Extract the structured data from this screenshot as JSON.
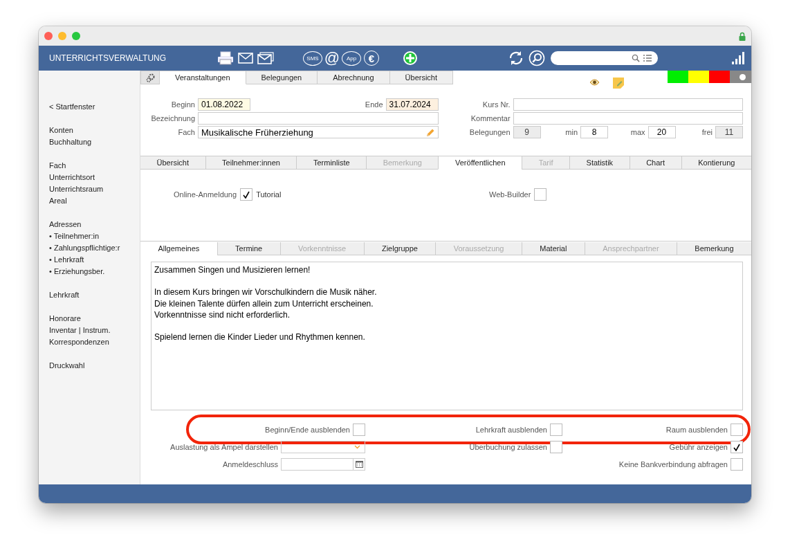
{
  "app": {
    "title": "UNTERRICHTSVERWALTUNG",
    "sms_label": "SMS",
    "at_label": "@",
    "app_label": "App",
    "euro_label": "€"
  },
  "status_colors": [
    {
      "color": "#00ee00"
    },
    {
      "color": "#ffff00"
    },
    {
      "color": "#ff0000"
    }
  ],
  "status_toggle": {
    "on": false
  },
  "top_tabs": [
    {
      "label": "Veranstaltungen",
      "selected": true
    },
    {
      "label": "Belegungen",
      "selected": false
    },
    {
      "label": "Abrechnung",
      "selected": false
    },
    {
      "label": "Übersicht",
      "selected": false
    }
  ],
  "sidebar": {
    "groups": [
      [
        {
          "label": "< Startfenster"
        }
      ],
      [
        {
          "label": "Konten"
        },
        {
          "label": "Buchhaltung"
        }
      ],
      [
        {
          "label": "Fach"
        },
        {
          "label": "Unterrichtsort"
        },
        {
          "label": "Unterrichtsraum"
        },
        {
          "label": "Areal"
        }
      ],
      [
        {
          "label": "Adressen"
        },
        {
          "label": "• Teilnehmer:in"
        },
        {
          "label": "• Zahlungspflichtige:r"
        },
        {
          "label": "• Lehrkraft"
        },
        {
          "label": "• Erziehungsber."
        }
      ],
      [
        {
          "label": "Lehrkraft"
        }
      ],
      [
        {
          "label": "Honorare"
        },
        {
          "label": "Inventar | Instrum."
        },
        {
          "label": "Korrespondenzen"
        }
      ],
      [
        {
          "label": "Druckwahl"
        }
      ]
    ]
  },
  "form": {
    "beginn": {
      "label": "Beginn",
      "value": "01.08.2022"
    },
    "ende": {
      "label": "Ende",
      "value": "31.07.2024"
    },
    "bezeichnung": {
      "label": "Bezeichnung"
    },
    "fach": {
      "label": "Fach",
      "value": "Musikalische Früherziehung"
    },
    "kurs_nr": {
      "label": "Kurs Nr."
    },
    "kommentar": {
      "label": "Kommentar"
    },
    "belegungen": {
      "label": "Belegungen",
      "value": "9"
    },
    "min": {
      "label": "min",
      "value": "8"
    },
    "max": {
      "label": "max",
      "value": "20"
    },
    "frei": {
      "label": "frei",
      "value": "11"
    }
  },
  "sub_tabs": [
    {
      "label": "Übersicht",
      "selected": false,
      "disabled": false
    },
    {
      "label": "Teilnehmer:innen",
      "selected": false,
      "disabled": false
    },
    {
      "label": "Terminliste",
      "selected": false,
      "disabled": false
    },
    {
      "label": "Bemerkung",
      "selected": false,
      "disabled": true
    },
    {
      "label": "Veröffentlichen",
      "selected": true,
      "disabled": false
    },
    {
      "label": "Tarif",
      "selected": false,
      "disabled": true
    },
    {
      "label": "Statistik",
      "selected": false,
      "disabled": false
    },
    {
      "label": "Chart",
      "selected": false,
      "disabled": false
    },
    {
      "label": "Kontierung",
      "selected": false,
      "disabled": false
    }
  ],
  "publish": {
    "online": {
      "label": "Online-Anmeldung",
      "checked": true,
      "link": "Tutorial"
    },
    "web_builder": {
      "label": "Web-Builder",
      "checked": false
    }
  },
  "detail_tabs": [
    {
      "label": "Allgemeines",
      "selected": true,
      "disabled": false
    },
    {
      "label": "Termine",
      "selected": false,
      "disabled": false
    },
    {
      "label": "Vorkenntnisse",
      "selected": false,
      "disabled": true
    },
    {
      "label": "Zielgruppe",
      "selected": false,
      "disabled": false
    },
    {
      "label": "Voraussetzung",
      "selected": false,
      "disabled": true
    },
    {
      "label": "Material",
      "selected": false,
      "disabled": false
    },
    {
      "label": "Ansprechpartner",
      "selected": false,
      "disabled": true
    },
    {
      "label": "Bemerkung",
      "selected": false,
      "disabled": false
    }
  ],
  "description": [
    [
      "Zusammen Singen und Musizieren lernen!"
    ],
    [
      "In diesem Kurs bringen wir Vorschulkindern die Musik näher.",
      "Die kleinen Talente dürfen allein zum Unterricht erscheinen.",
      "Vorkenntnisse sind nicht erforderlich."
    ],
    [
      "Spielend lernen die Kinder Lieder und Rhythmen kennen."
    ]
  ],
  "options": [
    {
      "highlighted": true,
      "cells": [
        {
          "label": "Beginn/Ende ausblenden",
          "kind": "checkbox",
          "checked": false
        },
        {
          "label": "Lehrkraft ausblenden",
          "kind": "checkbox",
          "checked": false
        },
        {
          "label": "Raum ausblenden",
          "kind": "checkbox",
          "checked": false
        }
      ]
    },
    {
      "highlighted": false,
      "cells": [
        {
          "label": "Auslastung als Ampel darstellen",
          "kind": "dropdown"
        },
        {
          "label": "Überbuchung zulassen",
          "kind": "checkbox",
          "checked": false
        },
        {
          "label": "Gebühr anzeigen",
          "kind": "checkbox",
          "checked": true
        }
      ]
    },
    {
      "highlighted": false,
      "cells": [
        {
          "label": "Anmeldeschluss",
          "kind": "date"
        },
        {
          "kind": "empty"
        },
        {
          "label": "Keine Bankverbindung abfragen",
          "kind": "checkbox",
          "checked": false
        }
      ]
    }
  ]
}
